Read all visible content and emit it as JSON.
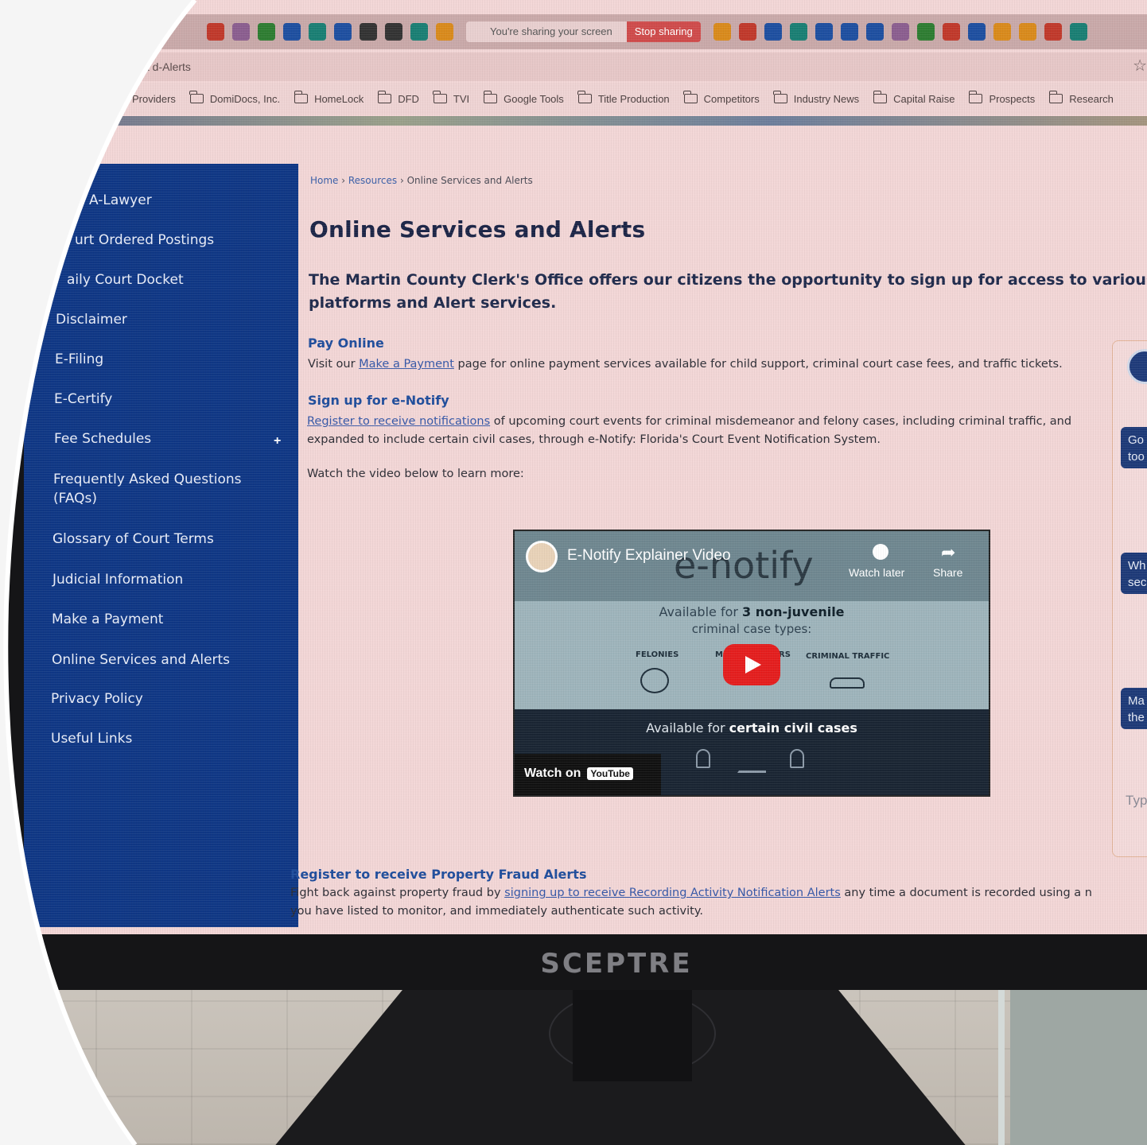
{
  "browser": {
    "sharing_text": "You're sharing your screen",
    "stop_sharing_label": "Stop sharing",
    "tab_title": "a  d-Alerts",
    "bookmarks": [
      "Providers",
      "DomiDocs, Inc.",
      "HomeLock",
      "DFD",
      "TVI",
      "Google Tools",
      "Title Production",
      "Competitors",
      "Industry News",
      "Capital Raise",
      "Prospects",
      "Research"
    ]
  },
  "sidebar": {
    "items": [
      "A-Lawyer",
      "urt Ordered Postings",
      "aily Court Docket",
      "Disclaimer",
      "E-Filing",
      "E-Certify",
      "Fee Schedules",
      "Frequently Asked Questions",
      "(FAQs)",
      "Glossary of Court Terms",
      "Judicial Information",
      "Make a Payment",
      "Online Services and Alerts",
      "Privacy Policy",
      "Useful Links"
    ],
    "expand_symbol": "+"
  },
  "breadcrumb": {
    "home": "Home",
    "sep1": " › ",
    "resources": "Resources",
    "sep2": " › ",
    "current": "Online Services and Alerts"
  },
  "page": {
    "title": "Online Services and Alerts",
    "intro_line1": "The Martin County Clerk's Office offers our citizens the opportunity to sign up for access to various Sear",
    "intro_line2": "platforms and Alert services."
  },
  "pay_online": {
    "heading": "Pay Online",
    "text_before": "Visit our ",
    "link": "Make a Payment",
    "text_after": " page for online payment services available for child support, criminal court case fees, and traffic tickets."
  },
  "enotify": {
    "heading": "Sign up for e-Notify",
    "link": "Register to receive notifications",
    "text_after": " of upcoming court events for criminal misdemeanor and felony cases, including criminal traffic, and",
    "line2": "expanded to include certain civil cases, through e-Notify: Florida's Court Event Notification System.",
    "watch_text": "Watch the video below to learn more:"
  },
  "video": {
    "title": "E-Notify Explainer Video",
    "logo_text": "e-notify",
    "watch_later": "Watch later",
    "share": "Share",
    "avail_prefix": "Available for ",
    "avail_bold": "3 non-juvenile",
    "avail_line2": "criminal case types:",
    "case_felonies": "FELONIES",
    "case_misdemeanors": "M",
    "case_misdemeanors_end": "RS",
    "case_traffic": "CRIMINAL TRAFFIC",
    "avail2_prefix": "Available for ",
    "avail2_bold": "certain civil cases",
    "watch_on": "Watch on",
    "youtube": "YouTube"
  },
  "chat": {
    "chips": [
      [
        "Go",
        "too"
      ],
      [
        "Wh",
        "sec"
      ],
      [
        "Ma",
        "the"
      ]
    ],
    "type_placeholder": "Typ"
  },
  "fraud": {
    "heading": "Register to receive Property Fraud Alerts",
    "text_before": "Fight back against property fraud by ",
    "link": "signing up to receive Recording Activity Notification Alerts",
    "text_after": " any time a document is recorded using a n",
    "line2": "you have listed to monitor, and immediately authenticate such activity."
  },
  "monitor": {
    "brand": "SCEPTRE"
  }
}
